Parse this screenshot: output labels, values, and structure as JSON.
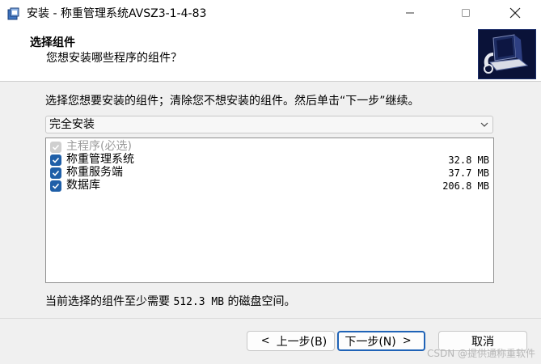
{
  "window": {
    "title": "安装 - 称重管理系统AVSZ3-1-4-83",
    "minimize_icon": "minimize-icon",
    "maximize_icon": "maximize-icon",
    "close_icon": "close-icon"
  },
  "header": {
    "title": "选择组件",
    "subtitle": "您想安装哪些程序的组件？"
  },
  "body": {
    "instruction": "选择您想要安装的组件；清除您不想安装的组件。然后单击“下一步”继续。",
    "install_type": {
      "selected": "完全安装"
    },
    "components": [
      {
        "label": "主程序(必选)",
        "size": "",
        "checked": true,
        "disabled": true
      },
      {
        "label": "称重管理系统",
        "size": "32.8 MB",
        "checked": true,
        "disabled": false
      },
      {
        "label": "称重服务端",
        "size": "37.7 MB",
        "checked": true,
        "disabled": false
      },
      {
        "label": "数据库",
        "size": "206.8 MB",
        "checked": true,
        "disabled": false
      }
    ],
    "space_prefix": "当前选择的组件至少需要",
    "space_value": "512.3 MB",
    "space_suffix": "的磁盘空间。"
  },
  "footer": {
    "back_label": "上一步(B)",
    "next_label": "下一步(N)",
    "cancel_label": "取消"
  },
  "watermark": "CSDN @提供通称重软件",
  "colors": {
    "accent": "#1f63b7",
    "checkbox": "#1f5fa8"
  }
}
